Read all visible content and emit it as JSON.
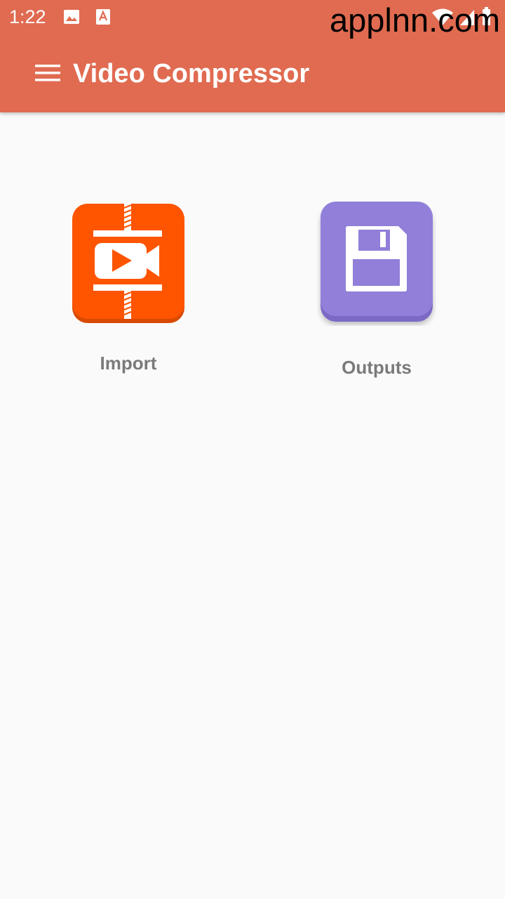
{
  "status_bar": {
    "time": "1:22",
    "icons": [
      "gallery-icon",
      "a-app-icon",
      "wifi-icon",
      "signal-icon",
      "battery-icon"
    ]
  },
  "watermark": "applnn.com",
  "app_bar": {
    "title": "Video Compressor",
    "menu_icon": "hamburger-menu-icon",
    "background": "#e06b51"
  },
  "tiles": [
    {
      "label": "Import",
      "icon": "video-compress-icon",
      "color": "#ff5400"
    },
    {
      "label": "Outputs",
      "icon": "floppy-save-icon",
      "color": "#917fd9"
    }
  ],
  "colors": {
    "background": "#fafafa",
    "label": "#7a7a7a"
  }
}
